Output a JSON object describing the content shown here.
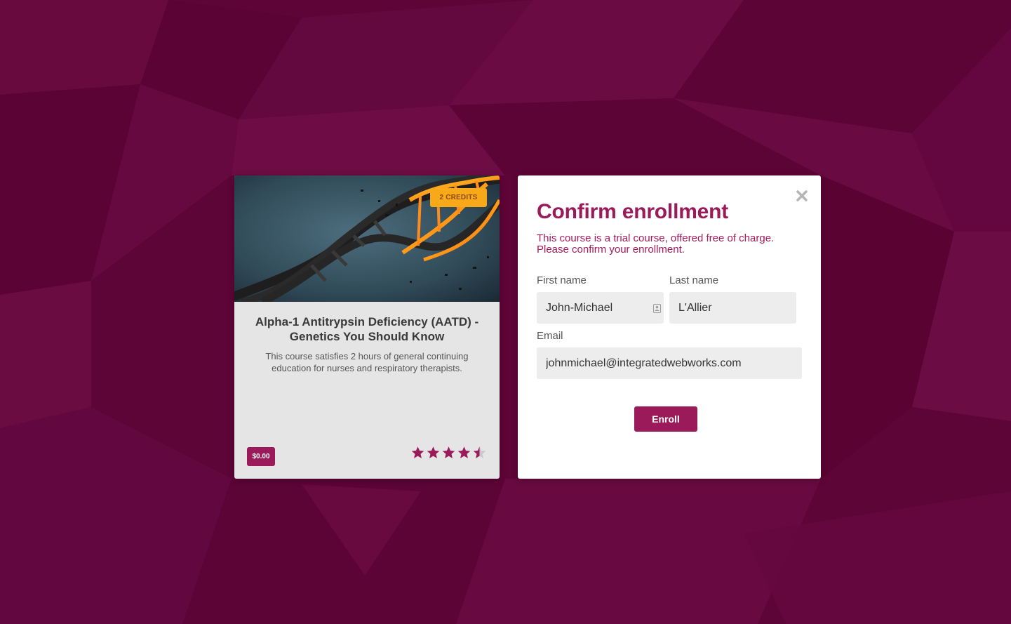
{
  "course": {
    "credits_badge": "2 CREDITS",
    "title": "Alpha-1 Antitrypsin Deficiency (AATD) - Genetics You Should Know",
    "description": "This course satisfies 2 hours of general continuing education for nurses and respiratory therapists.",
    "price": "$0.00",
    "rating_value": 4.5,
    "rating_max": 5,
    "image_icon": "dna-helix-image"
  },
  "modal": {
    "title": "Confirm enrollment",
    "message": "This course is a trial course, offered free of charge. Please confirm your enrollment.",
    "close_icon": "close-icon",
    "first_name_label": "First name",
    "first_name_value": "John-Michael",
    "last_name_label": "Last name",
    "last_name_value": "L'Allier",
    "email_label": "Email",
    "email_value": "johnmichael@integratedwebworks.com",
    "enroll_label": "Enroll"
  },
  "colors": {
    "background": "#5f0437",
    "brand": "#9b1b5a",
    "credits_badge": "#f7a919",
    "card_body": "#e6e5e6",
    "input_bg": "#ededed"
  }
}
